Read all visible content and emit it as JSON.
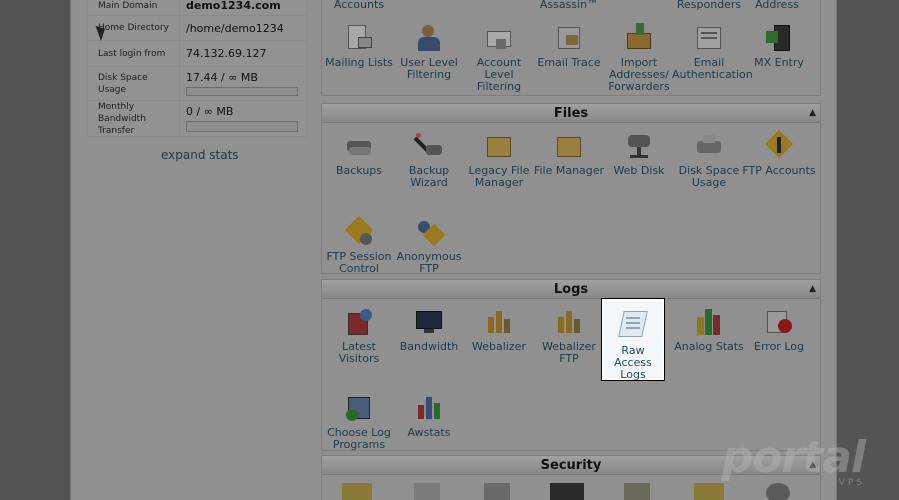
{
  "stats": {
    "rows": [
      {
        "label": "Main Domain",
        "value": "demo1234.com"
      },
      {
        "label": "Home Directory",
        "value": "/home/demo1234"
      },
      {
        "label": "Last login from",
        "value": "74.132.69.127"
      },
      {
        "label": "Disk Space Usage",
        "value": "17.44 / ∞ MB"
      },
      {
        "label": "Monthly Bandwidth Transfer",
        "value": "0 / ∞ MB"
      }
    ],
    "expand": "expand stats"
  },
  "top_row": {
    "headers": [
      "Accounts",
      "Assassin™",
      "Responders",
      "Address"
    ],
    "items": [
      "Mailing Lists",
      "User Level Filtering",
      "Account Level Filtering",
      "Email Trace",
      "Import Addresses/ Forwarders",
      "Email Authentication",
      "MX Entry"
    ]
  },
  "files": {
    "title": "Files",
    "items": [
      "Backups",
      "Backup Wizard",
      "Legacy File Manager",
      "File Manager",
      "Web Disk",
      "Disk Space Usage",
      "FTP Accounts",
      "FTP Session Control",
      "Anonymous FTP"
    ]
  },
  "logs": {
    "title": "Logs",
    "items": [
      "Latest Visitors",
      "Bandwidth",
      "Webalizer",
      "Webalizer FTP",
      "Raw Access Logs",
      "Analog Stats",
      "Error Log",
      "Choose Log Programs",
      "Awstats"
    ]
  },
  "security": {
    "title": "Security"
  },
  "watermark": {
    "line1": "portal",
    "line2": "VPS"
  },
  "colors": {
    "accent_text": "#1e3a4a",
    "highlight_bg": "#f4f7fa"
  }
}
